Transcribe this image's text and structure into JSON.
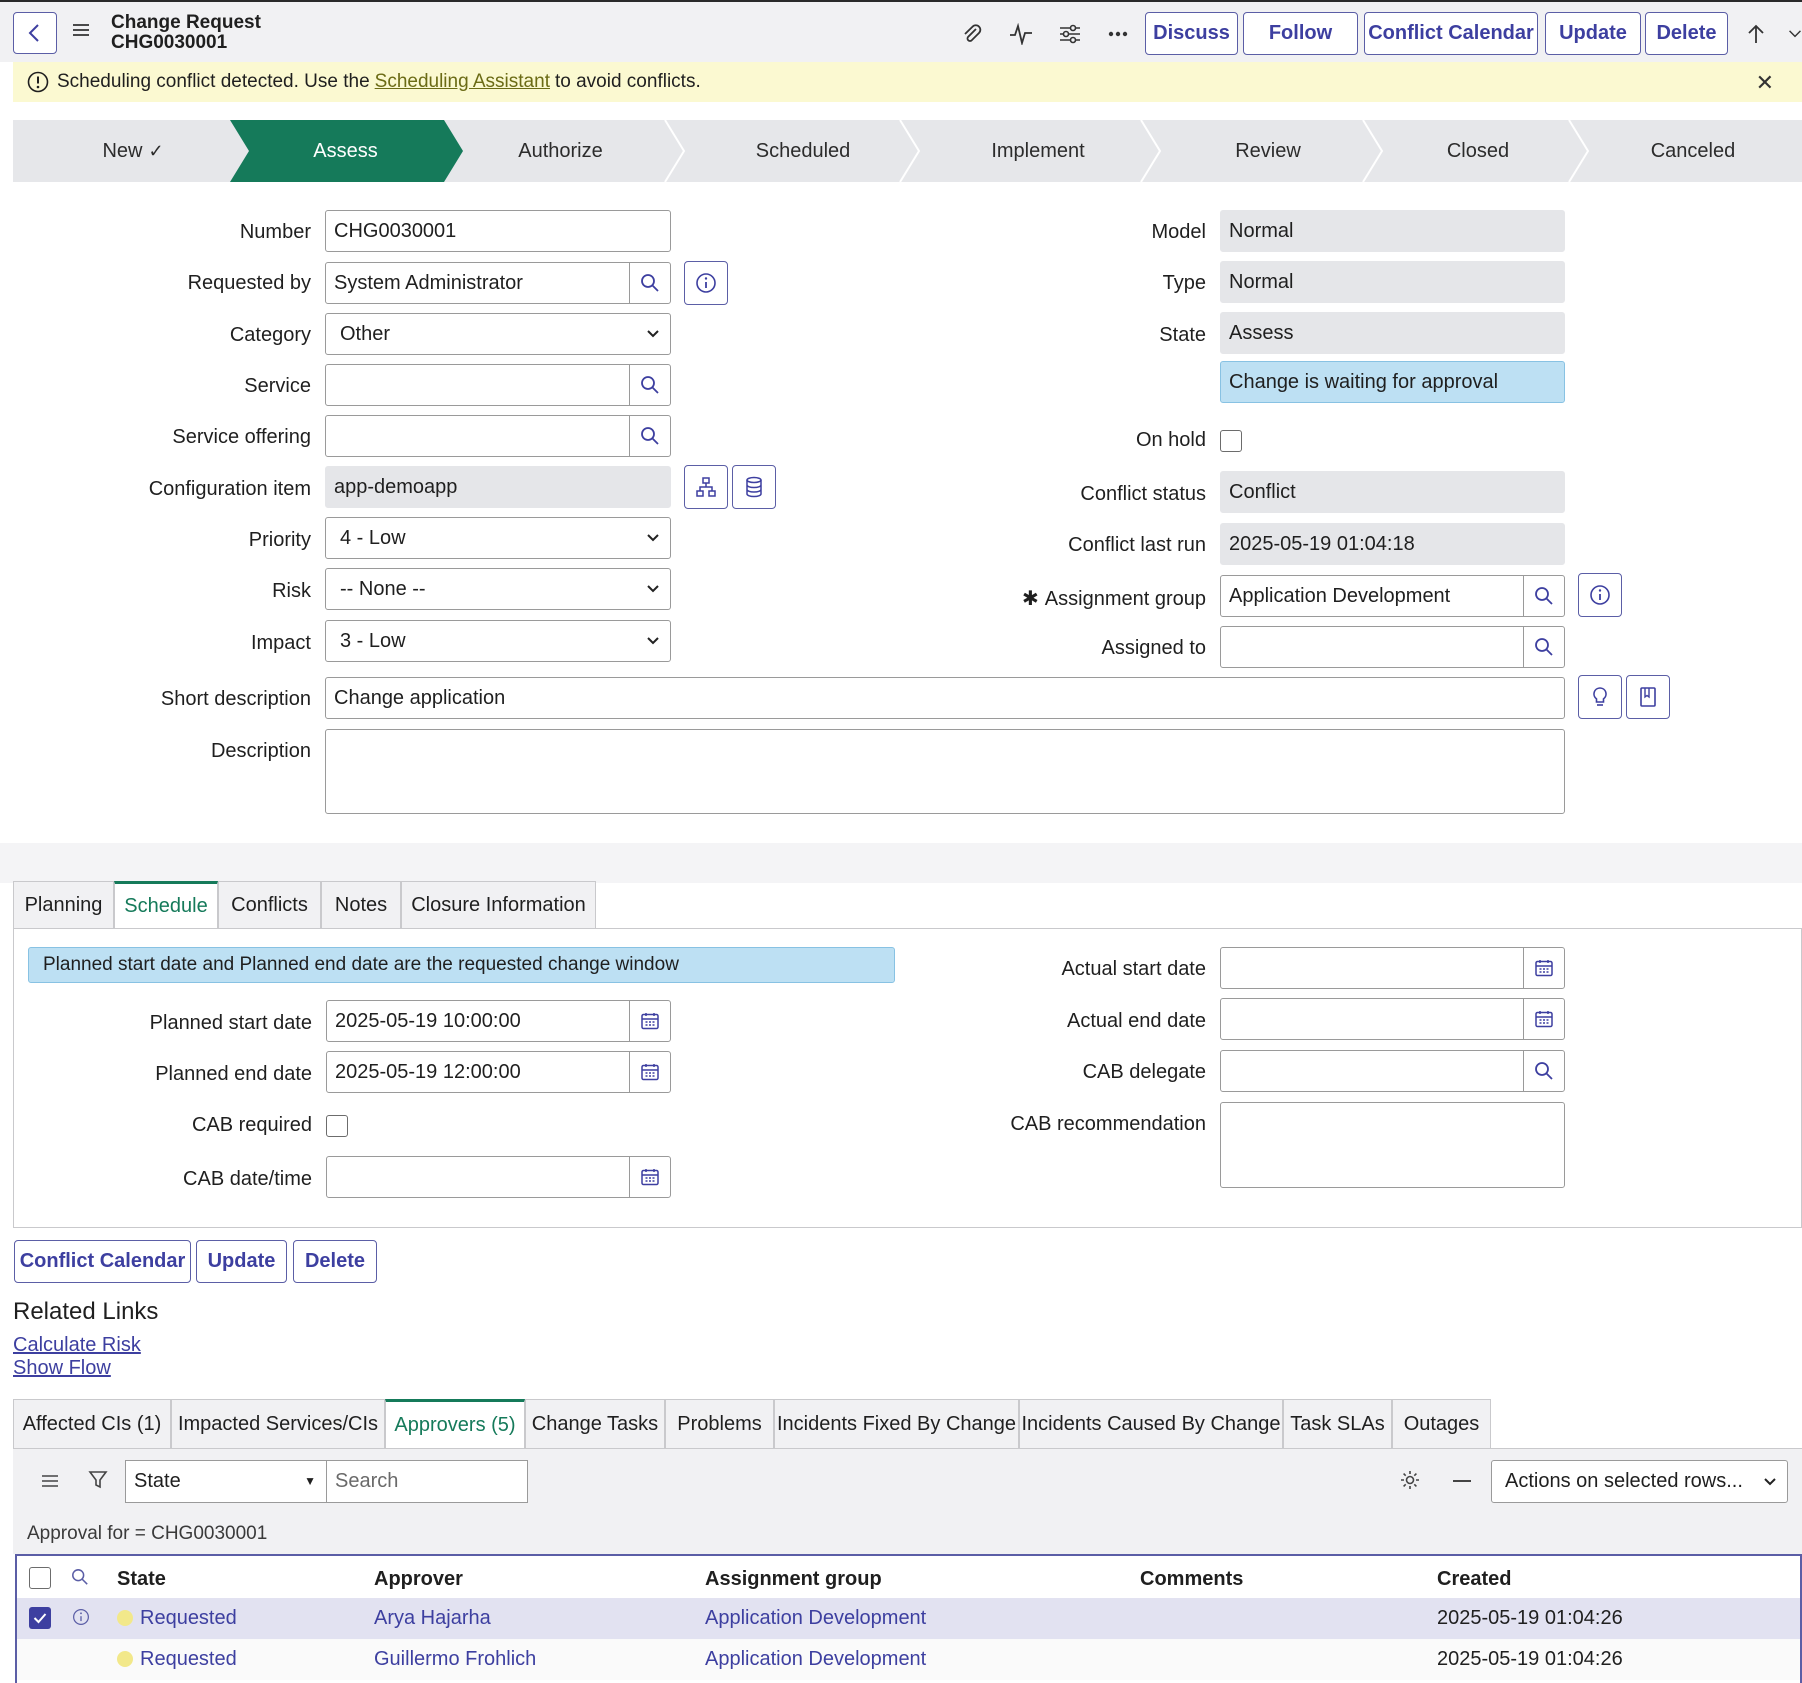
{
  "header": {
    "record_type": "Change Request",
    "record_number": "CHG0030001",
    "buttons": [
      "Discuss",
      "Follow",
      "Conflict Calendar",
      "Update",
      "Delete"
    ]
  },
  "banner": {
    "text_before": "Scheduling conflict detected. Use the",
    "link": "Scheduling Assistant",
    "text_after": "to avoid conflicts."
  },
  "stages": [
    "New",
    "Assess",
    "Authorize",
    "Scheduled",
    "Implement",
    "Review",
    "Closed",
    "Canceled"
  ],
  "form": {
    "left": {
      "number": {
        "label": "Number",
        "value": "CHG0030001"
      },
      "requested_by": {
        "label": "Requested by",
        "value": "System Administrator"
      },
      "category": {
        "label": "Category",
        "value": "Other"
      },
      "service": {
        "label": "Service",
        "value": ""
      },
      "service_offering": {
        "label": "Service offering",
        "value": ""
      },
      "configuration_item": {
        "label": "Configuration item",
        "value": "app-demoapp"
      },
      "priority": {
        "label": "Priority",
        "value": "4 - Low"
      },
      "risk": {
        "label": "Risk",
        "value": "-- None --"
      },
      "impact": {
        "label": "Impact",
        "value": "3 - Low"
      }
    },
    "right": {
      "model": {
        "label": "Model",
        "value": "Normal"
      },
      "type": {
        "label": "Type",
        "value": "Normal"
      },
      "state": {
        "label": "State",
        "value": "Assess"
      },
      "state_note": "Change is waiting for approval",
      "on_hold": {
        "label": "On hold"
      },
      "conflict_status": {
        "label": "Conflict status",
        "value": "Conflict"
      },
      "conflict_last_run": {
        "label": "Conflict last run",
        "value": "2025-05-19 01:04:18"
      },
      "assignment_group": {
        "label": "Assignment group",
        "value": "Application Development"
      },
      "assigned_to": {
        "label": "Assigned to",
        "value": ""
      }
    },
    "short_description": {
      "label": "Short description",
      "value": "Change application"
    },
    "description": {
      "label": "Description",
      "value": ""
    }
  },
  "tabs": [
    "Planning",
    "Schedule",
    "Conflicts",
    "Notes",
    "Closure Information"
  ],
  "schedule": {
    "info": "Planned start date and Planned end date are the requested change window",
    "planned_start": {
      "label": "Planned start date",
      "value": "2025-05-19 10:00:00"
    },
    "planned_end": {
      "label": "Planned end date",
      "value": "2025-05-19 12:00:00"
    },
    "cab_required": {
      "label": "CAB required"
    },
    "cab_datetime": {
      "label": "CAB date/time",
      "value": ""
    },
    "actual_start": {
      "label": "Actual start date",
      "value": ""
    },
    "actual_end": {
      "label": "Actual end date",
      "value": ""
    },
    "cab_delegate": {
      "label": "CAB delegate",
      "value": ""
    },
    "cab_recommendation": {
      "label": "CAB recommendation",
      "value": ""
    }
  },
  "bottom_buttons": [
    "Conflict Calendar",
    "Update",
    "Delete"
  ],
  "related_links": {
    "title": "Related Links",
    "links": [
      "Calculate Risk",
      "Show Flow"
    ]
  },
  "related_tabs": [
    "Affected CIs (1)",
    "Impacted Services/CIs",
    "Approvers (5)",
    "Change Tasks",
    "Problems",
    "Incidents Fixed By Change",
    "Incidents Caused By Change",
    "Task SLAs",
    "Outages"
  ],
  "list": {
    "search_field": "State",
    "search_placeholder": "Search",
    "actions": "Actions on selected rows...",
    "filter": "Approval for = CHG0030001",
    "columns": [
      "State",
      "Approver",
      "Assignment group",
      "Comments",
      "Created"
    ],
    "rows": [
      {
        "state": "Requested",
        "approver": "Arya Hajarha",
        "group": "Application Development",
        "comments": "",
        "created": "2025-05-19 01:04:26"
      },
      {
        "state": "Requested",
        "approver": "Guillermo Frohlich",
        "group": "Application Development",
        "comments": "",
        "created": "2025-05-19 01:04:26"
      }
    ]
  },
  "colors": {
    "accent": "#3d3fa0",
    "stage_active": "#157a5a",
    "banner": "#fbf9d1",
    "info": "#bde0f3"
  }
}
